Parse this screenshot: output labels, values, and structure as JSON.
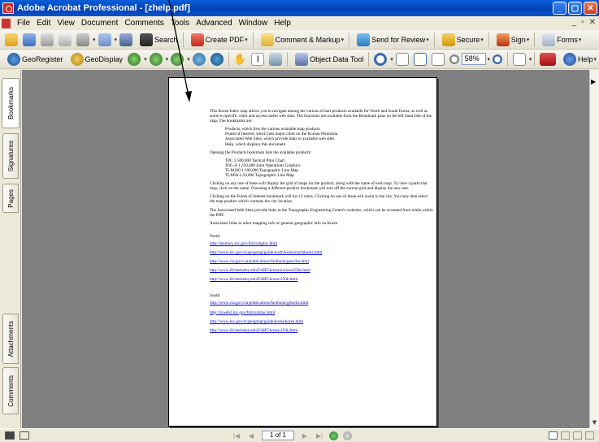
{
  "window": {
    "title": "Adobe Acrobat Professional - [zhelp.pdf]"
  },
  "window_controls": {
    "minimize": "_",
    "maximize": "▢",
    "close": "✕"
  },
  "menu": {
    "items": [
      "File",
      "Edit",
      "View",
      "Document",
      "Comments",
      "Tools",
      "Advanced",
      "Window",
      "Help"
    ],
    "doc_controls": [
      "_",
      "▫",
      "✕"
    ]
  },
  "toolbar1": {
    "search": "Search",
    "create_pdf": "Create PDF",
    "comment_markup": "Comment & Markup",
    "send_review": "Send for Review",
    "secure": "Secure",
    "sign": "Sign",
    "forms": "Forms"
  },
  "toolbar2": {
    "georegister": "GeoRegister",
    "geodisplay": "GeoDisplay",
    "object_data_tool": "Object Data Tool",
    "zoom": "58%",
    "help": "Help"
  },
  "nav_tabs": [
    "Bookmarks",
    "Signatures",
    "Pages",
    "Attachments",
    "Comments"
  ],
  "document": {
    "intro": "This Korea Index map allows you to navigate among the various eChart products available for North and South Korea, as well as zoom to specific cities and access useful web sites. The functions are available from the Bookmark pane on the left hand side of the map. The bookmarks are:",
    "bookmarks": [
      "Products, which lists the various available map products",
      "Points of Interest, which lists major cities on the Korean Peninsula",
      "Associated Web Sites, which provide links to available web sites",
      "Help, which displays this document"
    ],
    "products_intro": "Opening the Products bookmark lists the available products:",
    "products": [
      "TPC 1:500,000 Tactical Pilot Chart",
      "JOG-A 1:250,000 Joint Operations Graphics",
      "TLM100 1:100,000 Topographic Line Map",
      "TLM50 1:50,000 Topographic Line Map"
    ],
    "para_clicking": "Clicking on any one of these will display the grid of maps for the product, along with the name of each map. To view a particular map, click on the name. Choosing a different product bookmark will turn off the current grid and display the new one.",
    "para_points": "Clicking on the Points of Interest bookmark will list 13 cities. Clicking on one of these will zoom to the city. You may then select the map product which contains the city location.",
    "para_websites": "The Associated Web Sites provide links to the Topographic Engineering Center's websites, which can be accessed from while within the PDF.",
    "para_links": "Associated links to other mapping info or general geographic info on Korea",
    "north_label": "North:",
    "north_links": [
      "http://memory.loc.gov/frd/cs/kptoc.html",
      "http://www.loc.gov/rr/geogmap/guide/north/korea/northkorea.html",
      "http://www.cia.gov/cia/publications/factbook/geos/kn.html",
      "http://www.lib.berkeley.edu/EART/korea/n-korea250k.html",
      "http://www.lib.berkeley.edu/EART/korea-250k.html"
    ],
    "south_label": "South:",
    "south_links": [
      "http://www.cia.gov/cia/publications/factbook/geos/ks.html",
      "http://lcweb2.loc.gov/frd/cs/krtoc.html",
      "http://www.loc.gov/rr/geogmap/guide/korea/korea.html",
      "http://www.lib.berkeley.edu/EART/korea-250k.html"
    ]
  },
  "status": {
    "page": "1 of 1"
  },
  "colors": {
    "titlebar": "#0A52CC",
    "chrome": "#ECE9D8",
    "doc_bg": "#808080",
    "link": "#0000CC"
  }
}
